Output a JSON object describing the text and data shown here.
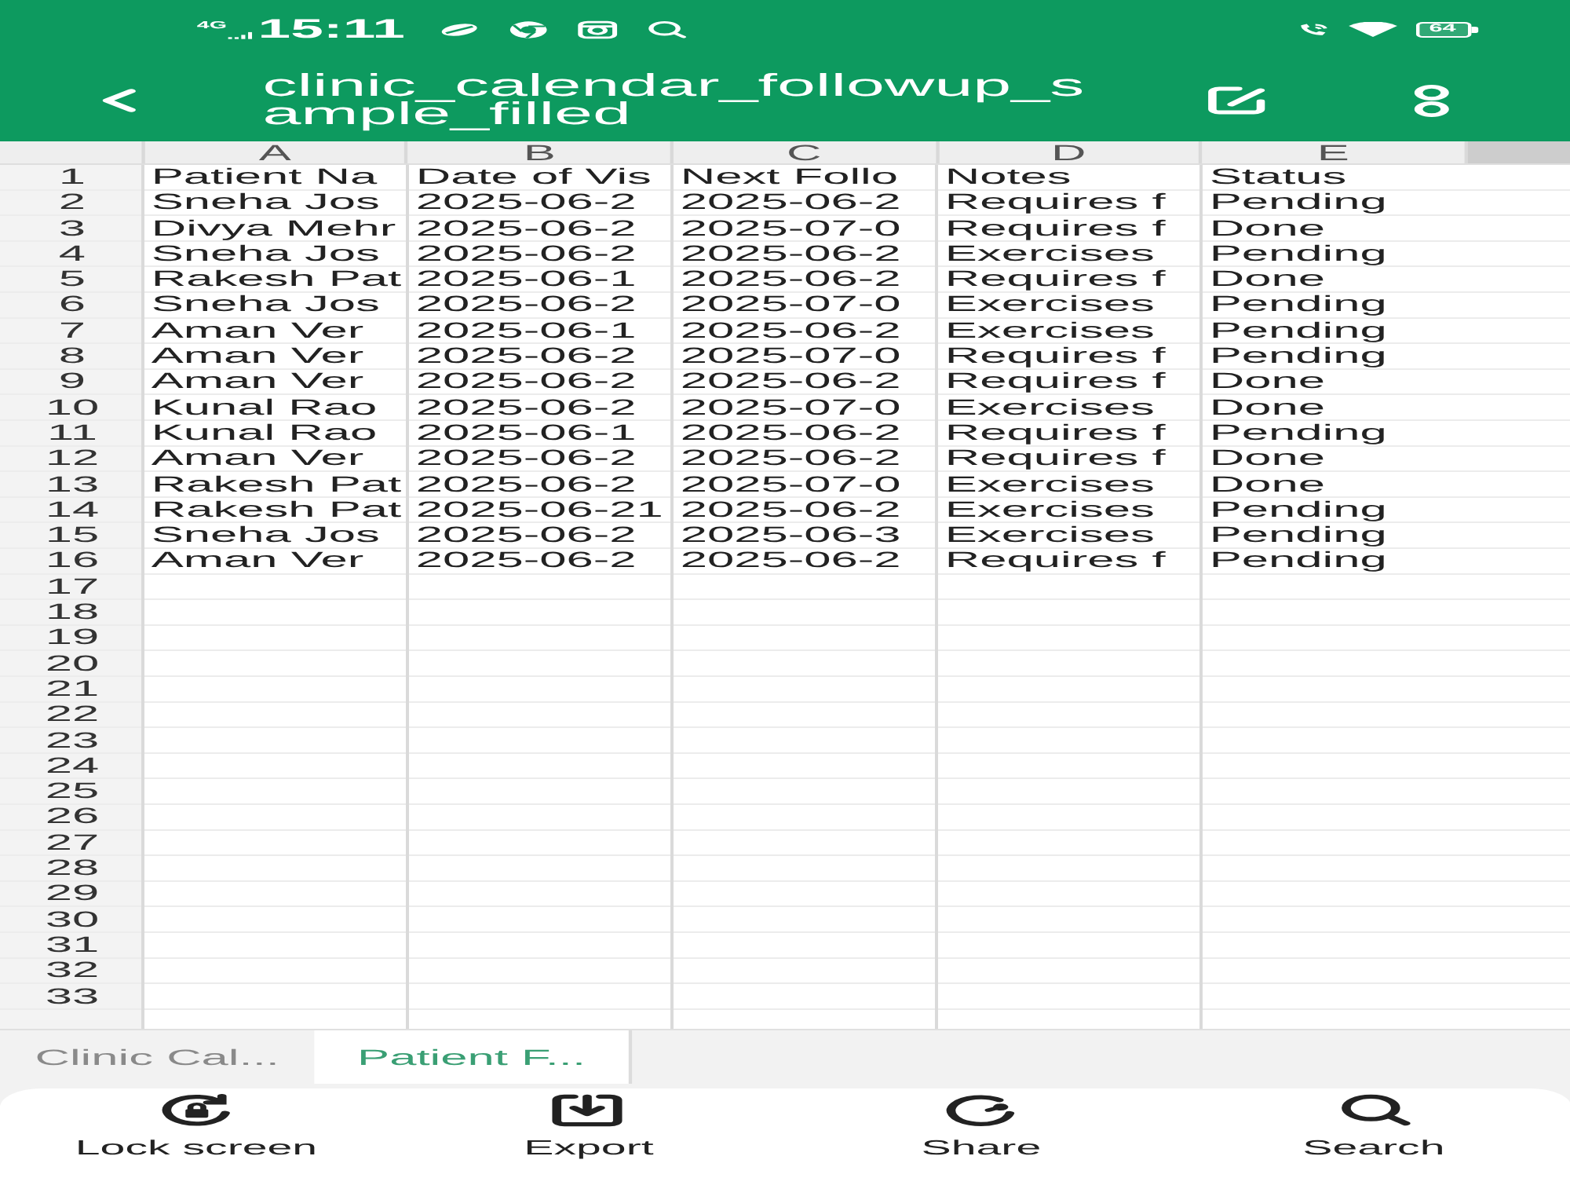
{
  "status_bar": {
    "network": "4G",
    "time": "15:11",
    "battery": "64"
  },
  "header": {
    "title": "clinic_calendar_followup_sample_filled"
  },
  "sheet": {
    "columns": [
      "A",
      "B",
      "C",
      "D",
      "E"
    ],
    "rows": [
      {
        "number": "1",
        "cells": [
          "Patient Na",
          "Date of Vis",
          "Next Follo",
          "Notes",
          "Status"
        ]
      },
      {
        "number": "2",
        "cells": [
          "Sneha Jos",
          "2025-06-2",
          "2025-06-2",
          "Requires f",
          "Pending"
        ]
      },
      {
        "number": "3",
        "cells": [
          "Divya Mehr",
          "2025-06-2",
          "2025-07-0",
          "Requires f",
          "Done"
        ]
      },
      {
        "number": "4",
        "cells": [
          "Sneha Jos",
          "2025-06-2",
          "2025-06-2",
          "Exercises",
          "Pending"
        ]
      },
      {
        "number": "5",
        "cells": [
          "Rakesh Pat",
          "2025-06-1",
          "2025-06-2",
          "Requires f",
          "Done"
        ]
      },
      {
        "number": "6",
        "cells": [
          "Sneha Jos",
          "2025-06-2",
          "2025-07-0",
          "Exercises",
          "Pending"
        ]
      },
      {
        "number": "7",
        "cells": [
          "Aman Ver",
          "2025-06-1",
          "2025-06-2",
          "Exercises",
          "Pending"
        ]
      },
      {
        "number": "8",
        "cells": [
          "Aman Ver",
          "2025-06-2",
          "2025-07-0",
          "Requires f",
          "Pending"
        ]
      },
      {
        "number": "9",
        "cells": [
          "Aman Ver",
          "2025-06-2",
          "2025-06-2",
          "Requires f",
          "Done"
        ]
      },
      {
        "number": "10",
        "cells": [
          "Kunal Rao",
          "2025-06-2",
          "2025-07-0",
          "Exercises",
          "Done"
        ]
      },
      {
        "number": "11",
        "cells": [
          "Kunal Rao",
          "2025-06-1",
          "2025-06-2",
          "Requires f",
          "Pending"
        ]
      },
      {
        "number": "12",
        "cells": [
          "Aman Ver",
          "2025-06-2",
          "2025-06-2",
          "Requires f",
          "Done"
        ]
      },
      {
        "number": "13",
        "cells": [
          "Rakesh Pat",
          "2025-06-2",
          "2025-07-0",
          "Exercises",
          "Done"
        ]
      },
      {
        "number": "14",
        "cells": [
          "Rakesh Pat",
          "2025-06-21",
          "2025-06-2",
          "Exercises",
          "Pending"
        ]
      },
      {
        "number": "15",
        "cells": [
          "Sneha Jos",
          "2025-06-2",
          "2025-06-3",
          "Exercises",
          "Pending"
        ]
      },
      {
        "number": "16",
        "cells": [
          "Aman Ver",
          "2025-06-2",
          "2025-06-2",
          "Requires f",
          "Pending"
        ]
      },
      {
        "number": "17"
      },
      {
        "number": "18"
      },
      {
        "number": "19"
      },
      {
        "number": "20"
      },
      {
        "number": "21"
      },
      {
        "number": "22"
      },
      {
        "number": "23"
      },
      {
        "number": "24"
      },
      {
        "number": "25"
      },
      {
        "number": "26"
      },
      {
        "number": "27"
      },
      {
        "number": "28"
      },
      {
        "number": "29"
      },
      {
        "number": "30"
      },
      {
        "number": "31"
      },
      {
        "number": "32"
      },
      {
        "number": "33"
      }
    ]
  },
  "sheet_tabs": [
    {
      "label": "Clinic Cal...",
      "selected": false
    },
    {
      "label": "Patient F...",
      "selected": true
    }
  ],
  "toolbar": [
    {
      "kind": "lock",
      "label": "Lock screen"
    },
    {
      "kind": "export",
      "label": "Export"
    },
    {
      "kind": "share",
      "label": "Share"
    },
    {
      "kind": "search",
      "label": "Search"
    }
  ]
}
